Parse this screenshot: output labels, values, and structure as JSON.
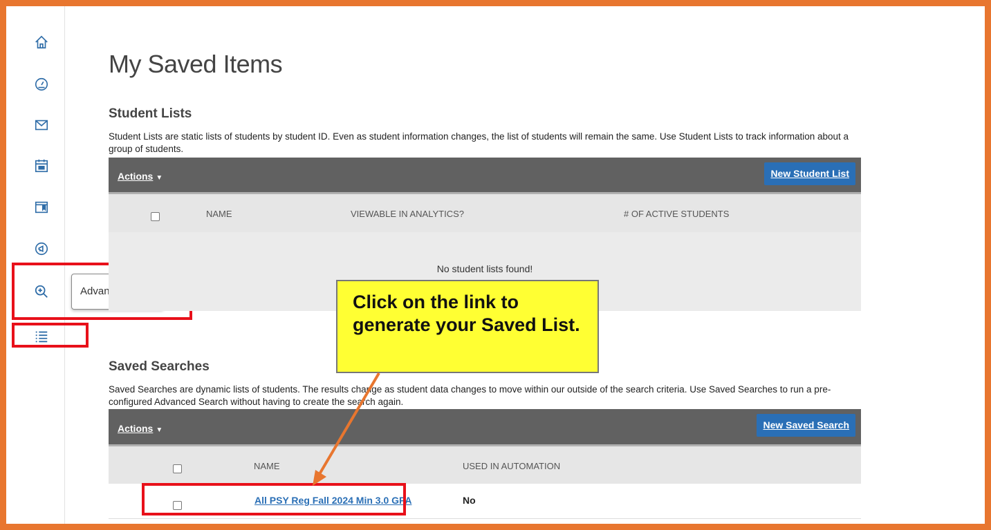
{
  "sidebar": {
    "icons": [
      "home-icon",
      "dashboard-gauge-icon",
      "mail-icon",
      "calendar-icon",
      "reports-icon",
      "announcement-icon",
      "advanced-search-icon",
      "saved-lists-icon"
    ],
    "tooltip": "Advanced Search"
  },
  "page": {
    "title": "My Saved Items"
  },
  "student_lists": {
    "title": "Student Lists",
    "description": "Student Lists are static lists of students by student ID. Even as student information changes, the list of students will remain the same. Use Student Lists to track information about a group of students.",
    "actions_label": "Actions",
    "new_button": "New Student List",
    "columns": [
      "NAME",
      "VIEWABLE IN ANALYTICS?",
      "# OF ACTIVE STUDENTS"
    ],
    "empty_message": "No student lists found!"
  },
  "saved_searches": {
    "title": "Saved Searches",
    "description": "Saved Searches are dynamic lists of students. The results change as student data changes to move within our outside of the search criteria. Use Saved Searches to run a pre-configured Advanced Search without having to create the search again.",
    "actions_label": "Actions",
    "new_button": "New Saved Search",
    "columns": [
      "NAME",
      "USED IN AUTOMATION"
    ],
    "rows": [
      {
        "name": "All PSY Reg Fall 2024 Min 3.0 GPA",
        "used_in_automation": "No"
      }
    ]
  },
  "callout": {
    "text": "Click on the link to generate your Saved List."
  },
  "colors": {
    "frame": "#E8762F",
    "highlight": "#e8101a",
    "callout_bg": "#ffff33",
    "primary": "#2a6fb6",
    "toolbar": "#616161"
  }
}
